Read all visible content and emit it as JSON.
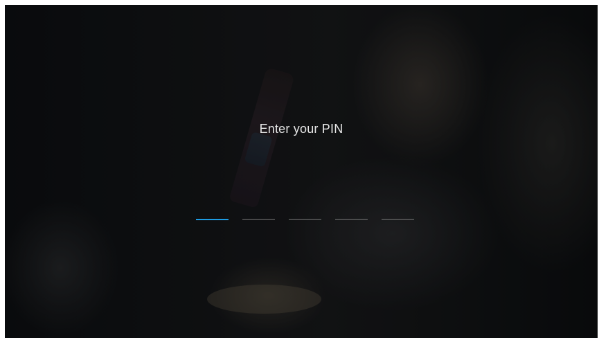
{
  "pin_prompt": {
    "title": "Enter your PIN",
    "slots": [
      {
        "state": "active"
      },
      {
        "state": "empty"
      },
      {
        "state": "empty"
      },
      {
        "state": "empty"
      },
      {
        "state": "empty"
      }
    ]
  },
  "colors": {
    "accent": "#1d9be2",
    "inactive_slot": "#7b7b7b",
    "title_text": "#e6e6e6"
  }
}
